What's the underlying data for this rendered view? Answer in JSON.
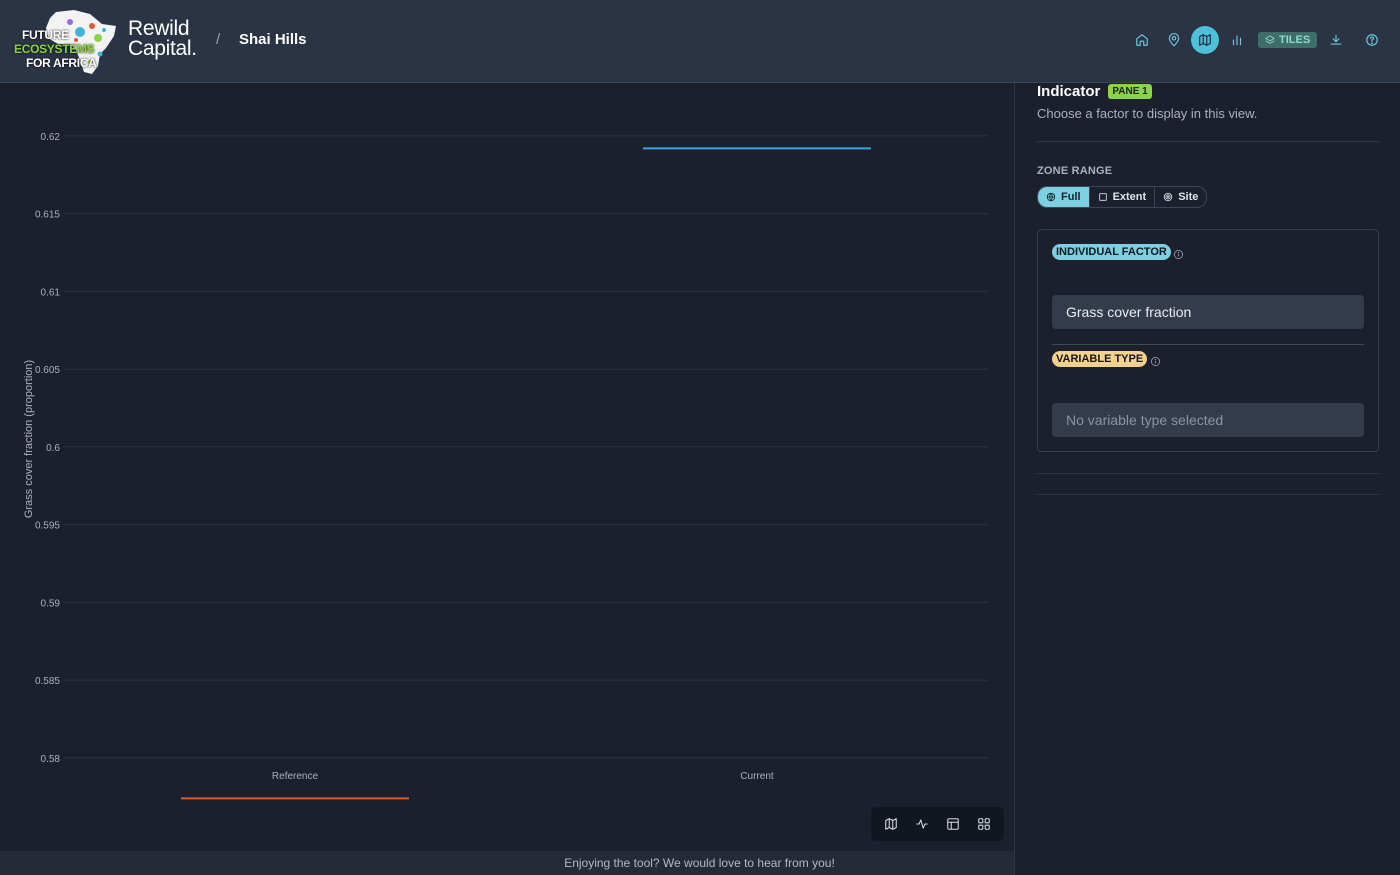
{
  "header": {
    "logo_lines": [
      "FUTURE",
      "ECOSYSTEMS",
      "FOR AFRICA"
    ],
    "brand_line1": "Rewild",
    "brand_line2": "Capital.",
    "separator": "/",
    "site_name": "Shai Hills",
    "nav": [
      {
        "icon": "home-icon"
      },
      {
        "icon": "map-pin-icon"
      },
      {
        "icon": "map-icon",
        "active": true
      },
      {
        "icon": "bar-chart-icon"
      }
    ],
    "tiles_label": "TILES"
  },
  "chart_data": {
    "type": "line",
    "ylabel": "Grass cover fraction (proportion)",
    "xlabel": "",
    "categories": [
      "Reference",
      "Current"
    ],
    "yticks": [
      0.58,
      0.585,
      0.59,
      0.595,
      0.6,
      0.605,
      0.61,
      0.615,
      0.62
    ],
    "ylim": [
      0.5771,
      0.6234
    ],
    "grid": true,
    "series": [
      {
        "category": "Reference",
        "value": 0.5774,
        "color": "#e0592a"
      },
      {
        "category": "Current",
        "value": 0.6192,
        "color": "#3aa8dc"
      }
    ]
  },
  "footer": {
    "text": "Enjoying the tool? We would love to hear from you!"
  },
  "toolbar": {
    "icons": [
      "map-view-icon",
      "line-chart-icon",
      "table-icon",
      "grid-icon"
    ]
  },
  "panel": {
    "title": "Indicator",
    "pane_badge": "PANE 1",
    "subtitle": "Choose a factor to display in this view.",
    "zone_range_label": "ZONE RANGE",
    "zone_options": [
      "Full",
      "Extent",
      "Site"
    ],
    "individual_factor_label": "INDIVIDUAL FACTOR",
    "factor_value": "Grass cover fraction",
    "variable_type_label": "VARIABLE TYPE",
    "variable_type_placeholder": "No variable type selected"
  }
}
